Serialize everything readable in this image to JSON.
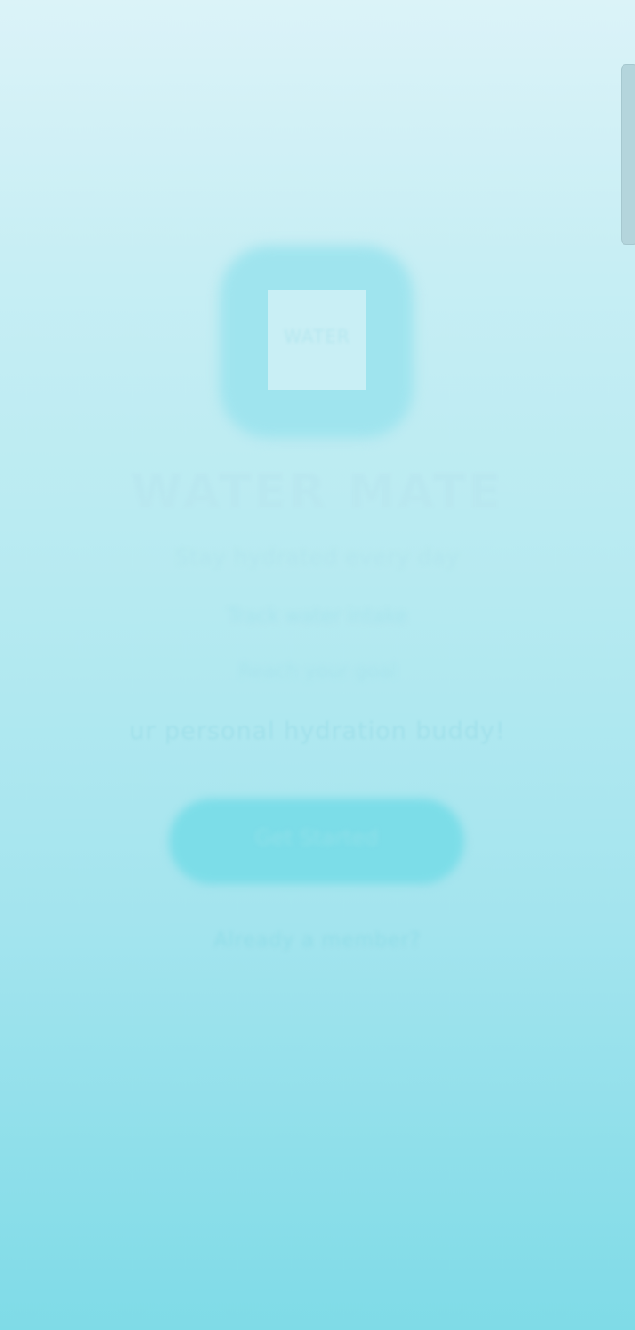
{
  "app": {
    "title": "WATER MATE",
    "logo_text": "WATER",
    "tagline": "Stay hydrated every day",
    "line_one": "Track water intake",
    "line_two": "Reach your goal",
    "subtitle": "ur personal hydration buddy!",
    "cta_label": "Get Started",
    "secondary_link": "Already a member?"
  },
  "icons": {
    "logo": "water-drop-logo-icon"
  },
  "colors": {
    "background_top": "#dbf3f8",
    "background_bottom": "#7fdbe7",
    "accent": "#7cdde8"
  }
}
